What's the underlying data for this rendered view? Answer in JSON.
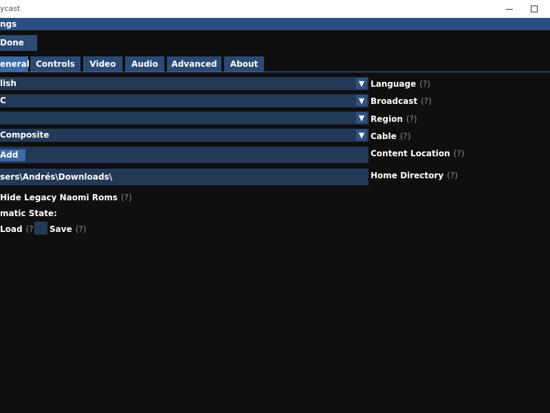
{
  "window": {
    "title": "ycast"
  },
  "header": {
    "title": "ngs"
  },
  "done_label": "Done",
  "tabs": [
    {
      "label": "eneral",
      "active": true
    },
    {
      "label": "Controls"
    },
    {
      "label": "Video"
    },
    {
      "label": "Audio"
    },
    {
      "label": "Advanced"
    },
    {
      "label": "About"
    }
  ],
  "settings": {
    "language": {
      "value": "lish",
      "label": "Language",
      "help": "(?)"
    },
    "broadcast": {
      "value": "C",
      "label": "Broadcast",
      "help": "(?)"
    },
    "region": {
      "value": "",
      "label": "Region",
      "help": "(?)"
    },
    "cable": {
      "value": "Composite",
      "label": "Cable",
      "help": "(?)"
    },
    "content_location": {
      "add_label": "Add",
      "label": "Content Location",
      "help": "(?)"
    },
    "home_directory": {
      "value": "sers\\Andrés\\Downloads\\",
      "label": "Home Directory",
      "help": "(?)"
    },
    "hide_legacy": {
      "label": "Hide Legacy Naomi Roms",
      "help": "(?)"
    },
    "auto_state": {
      "label": "matic State:"
    },
    "load": {
      "label": "Load",
      "help": "(?)"
    },
    "save": {
      "label": "Save",
      "help": "(?)"
    }
  },
  "icons": {
    "dropdown": "chevron-down-icon"
  }
}
